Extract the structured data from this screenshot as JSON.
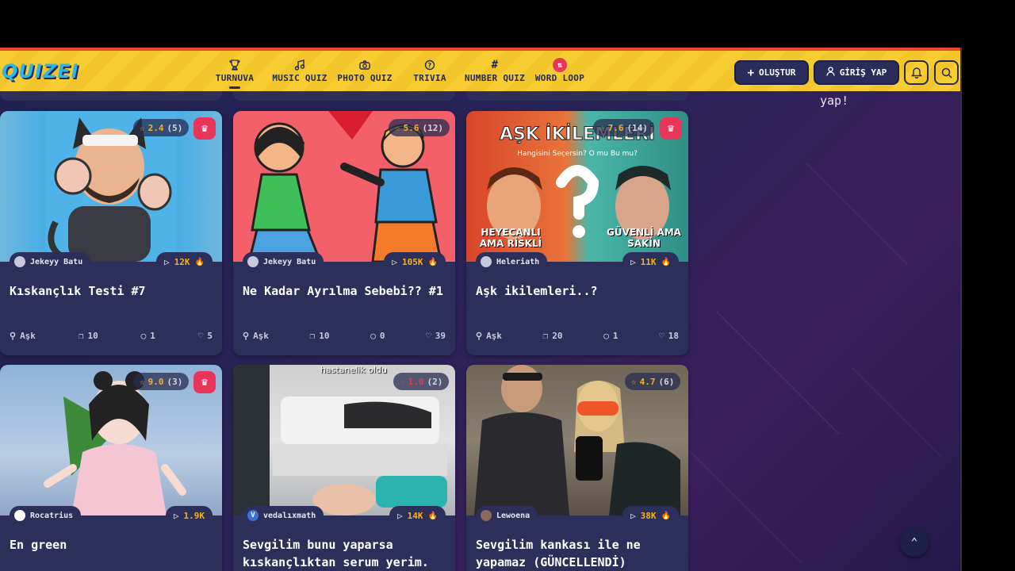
{
  "app": {
    "logo_text": "QUIZEI"
  },
  "nav": [
    {
      "label": "TURNUVA",
      "icon": "trophy-icon",
      "active": true
    },
    {
      "label": "MUSIC QUIZ",
      "icon": "music-note-icon",
      "active": false
    },
    {
      "label": "PHOTO QUIZ",
      "icon": "camera-icon",
      "active": false
    },
    {
      "label": "TRIVIA",
      "icon": "question-bubble-icon",
      "active": false
    },
    {
      "label": "NUMBER QUIZ",
      "icon": "hash-icon",
      "active": false
    },
    {
      "label": "WORD LOOP",
      "icon": "word-loop-icon",
      "active": false
    }
  ],
  "header": {
    "create_label": "OLUŞTUR",
    "login_label": "GİRİŞ YAP"
  },
  "side": {
    "text": "yap!"
  },
  "cards": [
    {
      "rating": "2.4",
      "rating_count": "(5)",
      "author": "Jekeyy Batu",
      "plays": "12K",
      "title": "Kıskançlık Testi #7",
      "category": "Aşk",
      "questions": "10",
      "comments": "1",
      "likes": "5"
    },
    {
      "rating": "5.6",
      "rating_count": "(12)",
      "author": "Jekeyy Batu",
      "plays": "105K",
      "title": "Ne Kadar Ayrılma Sebebi?? #1",
      "category": "Aşk",
      "questions": "10",
      "comments": "0",
      "likes": "39"
    },
    {
      "rating": "7.6",
      "rating_count": "(14)",
      "author": "Heleriath",
      "plays": "11K",
      "title": "Aşk ikilemleri..?",
      "category": "Aşk",
      "questions": "20",
      "comments": "1",
      "likes": "18",
      "image_text": {
        "top": "AŞK İKİLEMLERİ",
        "sub": "Hangisini Seçersin? O mu Bu mu?",
        "left": "HEYECANLI AMA RİSKLİ",
        "right": "GÜVENLİ AMA SAKİN"
      }
    },
    {
      "rating": "9.0",
      "rating_count": "(3)",
      "author": "Rocatrius",
      "plays": "1.9K",
      "title": "En green"
    },
    {
      "rating": "1.0",
      "rating_count": "(2)",
      "author": "vedalıxmath",
      "plays": "14K",
      "title": "Sevgilim bunu yaparsa kıskançlıktan serum yerim.",
      "image_text": {
        "top": "hastanelik oldu"
      }
    },
    {
      "rating": "4.7",
      "rating_count": "(6)",
      "author": "Lewoena",
      "plays": "38K",
      "title": "Sevgilim kankası ile ne yapamaz (GÜNCELLENDİ)"
    }
  ]
}
